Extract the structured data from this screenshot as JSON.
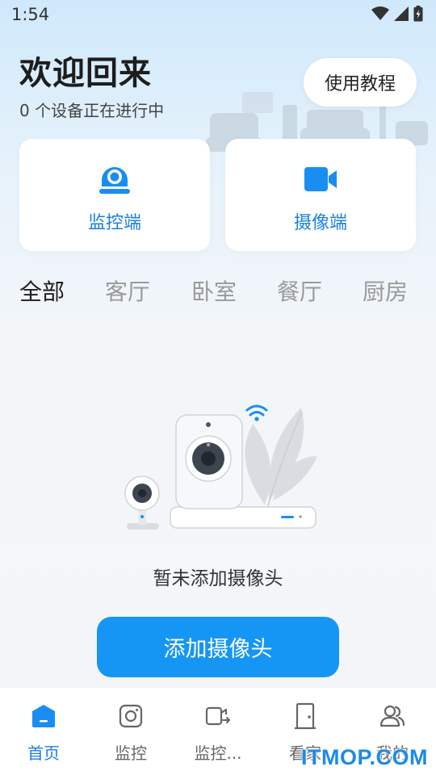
{
  "status_bar": {
    "time": "1:54",
    "icons": [
      "wifi-icon",
      "signal-icon",
      "battery-icon"
    ]
  },
  "header": {
    "title": "欢迎回来",
    "subtitle": "0 个设备正在进行中",
    "tutorial_label": "使用教程"
  },
  "cards": [
    {
      "label": "监控端",
      "icon": "monitor-camera-icon"
    },
    {
      "label": "摄像端",
      "icon": "video-camera-icon"
    }
  ],
  "room_tabs": [
    {
      "label": "全部",
      "active": true
    },
    {
      "label": "客厅",
      "active": false
    },
    {
      "label": "卧室",
      "active": false
    },
    {
      "label": "餐厅",
      "active": false
    },
    {
      "label": "厨房",
      "active": false
    }
  ],
  "empty_state": {
    "message": "暂未添加摄像头",
    "button_label": "添加摄像头"
  },
  "bottom_nav": [
    {
      "label": "首页",
      "icon": "home-icon",
      "active": true
    },
    {
      "label": "监控",
      "icon": "camera-icon",
      "active": false
    },
    {
      "label": "监控...",
      "icon": "video-switch-icon",
      "active": false
    },
    {
      "label": "看家",
      "icon": "door-icon",
      "active": false
    },
    {
      "label": "我的",
      "icon": "users-icon",
      "active": false
    }
  ],
  "watermark": "ITMOP.COM",
  "colors": {
    "accent": "#1596f5",
    "accent_text": "#1a7fe0",
    "background_top": "#cfe9fb"
  }
}
